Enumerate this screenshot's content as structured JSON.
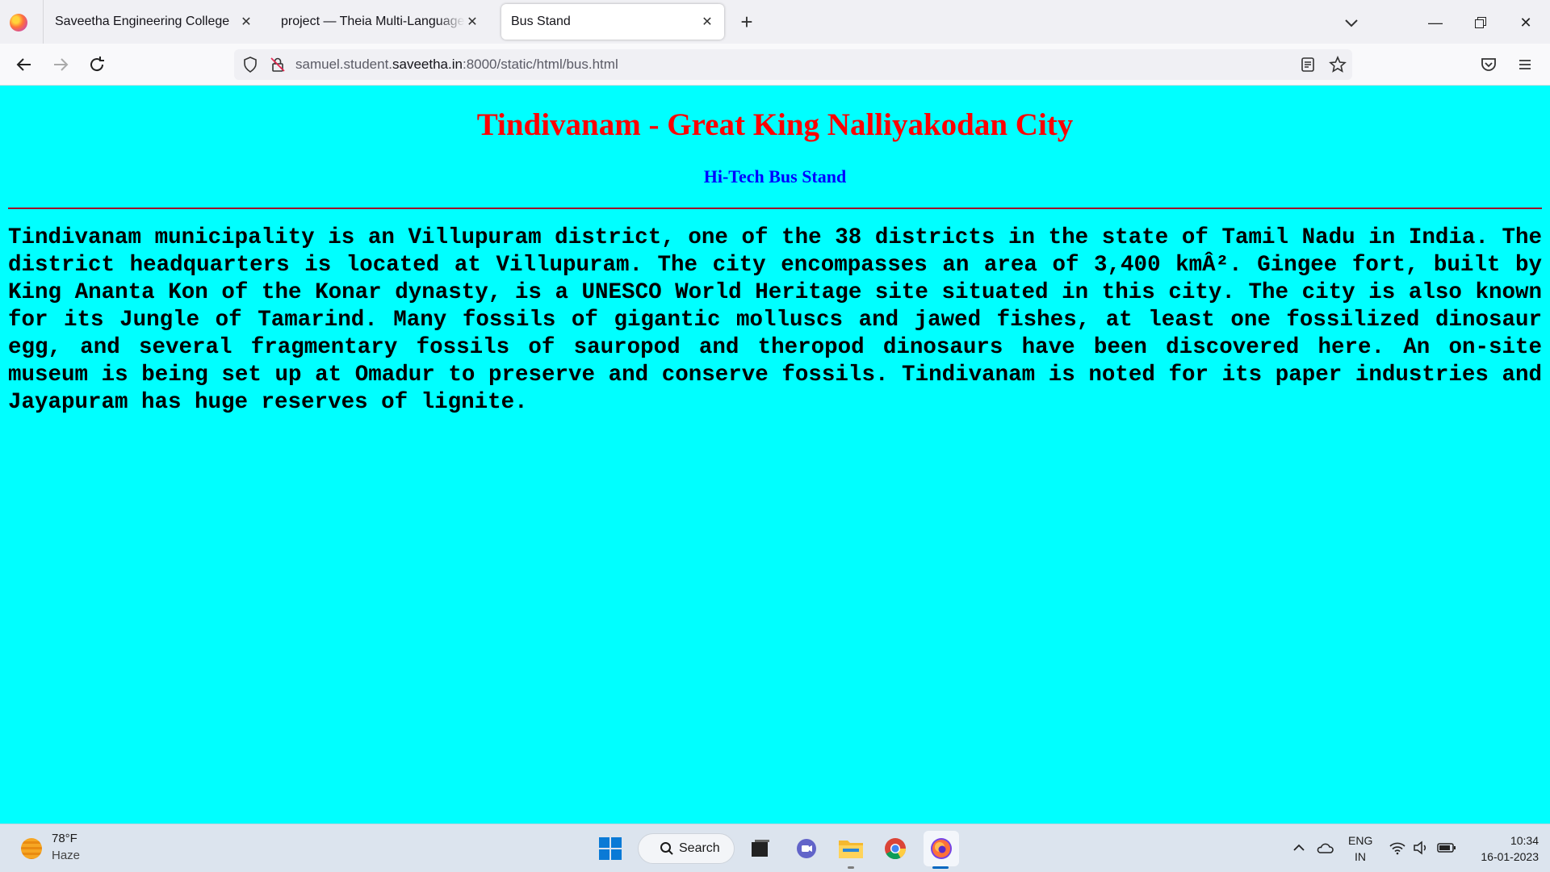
{
  "browser": {
    "tabs": [
      {
        "label": "Saveetha Engineering College",
        "active": false
      },
      {
        "label": "project — Theia Multi-Language Explorer",
        "active": false
      },
      {
        "label": "Bus Stand",
        "active": true
      }
    ],
    "url": {
      "prefix": "samuel.student.",
      "domain": "saveetha.in",
      "suffix": ":8000/static/html/bus.html"
    }
  },
  "page": {
    "title": "Tindivanam - Great King Nalliyakodan City",
    "subtitle": "Hi-Tech Bus Stand",
    "paragraph": "Tindivanam municipality is an Villupuram district, one of the 38 districts in the state of Tamil Nadu in India. The district headquarters is located at Villupuram. The city encompasses an area of 3,400 kmÂ². Gingee fort, built by King Ananta Kon of the Konar dynasty, is a UNESCO World Heritage site situated in this city. The city is also known for its Jungle of Tamarind. Many fossils of gigantic molluscs and jawed fishes, at least one fossilized dinosaur egg, and several fragmentary fossils of sauropod and theropod dinosaurs have been discovered here. An on-site museum is being set up at Omadur to preserve and conserve fossils. Tindivanam is noted for its paper industries and Jayapuram has huge reserves of lignite."
  },
  "taskbar": {
    "weather": {
      "temp": "78°F",
      "condition": "Haze"
    },
    "search_label": "Search",
    "language": {
      "line1": "ENG",
      "line2": "IN"
    },
    "time": "10:34",
    "date": "16-01-2023"
  },
  "colors": {
    "page_bg": "#00ffff",
    "title": "#ff0000",
    "subtitle": "#0000ff"
  }
}
